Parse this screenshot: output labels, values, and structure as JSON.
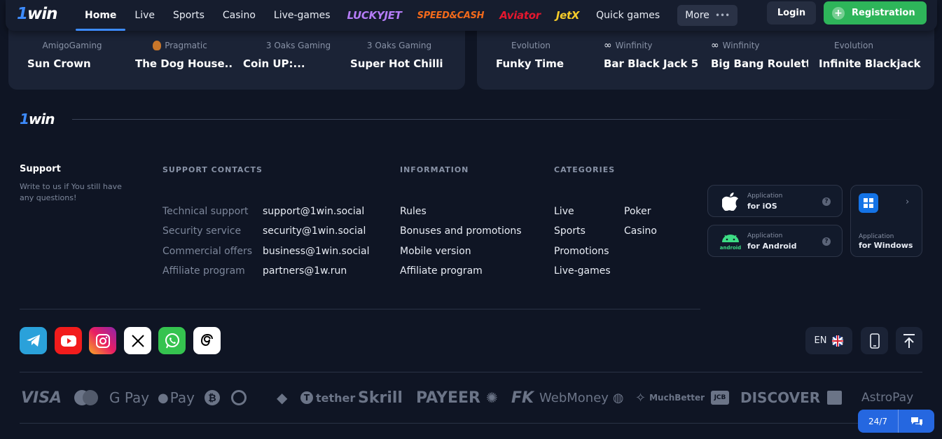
{
  "header": {
    "logo": {
      "one": "1",
      "win": "win"
    },
    "nav": [
      {
        "label": "Home",
        "active": true
      },
      {
        "label": "Live"
      },
      {
        "label": "Sports"
      },
      {
        "label": "Casino"
      },
      {
        "label": "Live-games"
      }
    ],
    "brands": [
      "LUCKYJET",
      "SPEED&CASH",
      "Aviator",
      "JetX"
    ],
    "quick_games": "Quick games",
    "more": "More",
    "login": "Login",
    "registration": "Registration"
  },
  "games_left": [
    {
      "provider": "AmigoGaming",
      "name": "Sun Crown"
    },
    {
      "provider": "Pragmatic",
      "name": "The Dog House..."
    },
    {
      "provider": "3 Oaks Gaming",
      "name": "Coin UP:..."
    },
    {
      "provider": "3 Oaks Gaming",
      "name": "Super Hot Chilli"
    }
  ],
  "games_right": [
    {
      "provider": "Evolution",
      "name": "Funky Time"
    },
    {
      "provider": "Winfinity",
      "name": "Bar Black Jack 5"
    },
    {
      "provider": "Winfinity",
      "name": "Big Bang Roulette"
    },
    {
      "provider": "Evolution",
      "name": "Infinite Blackjack"
    }
  ],
  "footer": {
    "logo": {
      "one": "1",
      "win": "win"
    },
    "support": {
      "title": "Support",
      "subtitle": "Write to us if You still have any questions!"
    },
    "support_contacts": {
      "heading": "SUPPORT CONTACTS",
      "rows": [
        {
          "label": "Technical support",
          "value": "support@1win.social"
        },
        {
          "label": "Security service",
          "value": "security@1win.social"
        },
        {
          "label": "Commercial offers",
          "value": "business@1win.social"
        },
        {
          "label": "Affiliate program",
          "value": "partners@1w.run"
        }
      ]
    },
    "information": {
      "heading": "INFORMATION",
      "items": [
        "Rules",
        "Bonuses and promotions",
        "Mobile version",
        "Affiliate program"
      ]
    },
    "categories": {
      "heading": "CATEGORIES",
      "col1": [
        "Live",
        "Sports",
        "Promotions",
        "Live-games"
      ],
      "col2": [
        "Poker",
        "Casino"
      ]
    },
    "apps": {
      "ios": {
        "top": "Application",
        "bottom": "for iOS"
      },
      "android": {
        "top": "Application",
        "bottom": "for Android"
      },
      "windows": {
        "top": "Application",
        "bottom": "for Windows"
      }
    },
    "social": [
      "telegram",
      "youtube",
      "instagram",
      "x",
      "whatsapp",
      "threads"
    ],
    "language": "EN",
    "payments": [
      "VISA",
      "G Pay",
      "Pay",
      "tether",
      "Skrill",
      "PAYEER",
      "WebMoney",
      "MuchBetter",
      "DISCOVER",
      "AstroPay"
    ],
    "chat": {
      "label": "24/7"
    }
  },
  "colors": {
    "accent": "#3d8bfd",
    "registration": "#2eb55a",
    "background": "#0f1524",
    "panel": "#1b2336"
  }
}
